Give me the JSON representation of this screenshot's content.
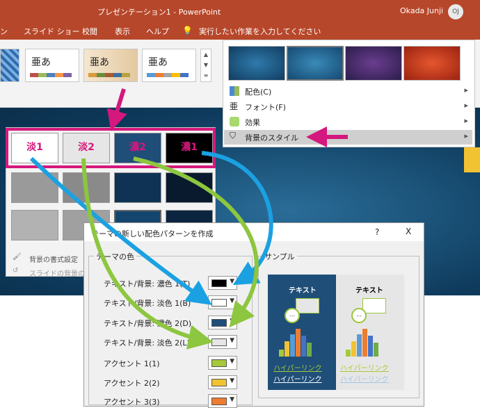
{
  "window": {
    "title": "プレゼンテーション1 - PowerPoint",
    "user": "Okada Junji",
    "user_initials": "OJ"
  },
  "menu": {
    "items": [
      "ン",
      "スライド ショー",
      "校閲",
      "表示",
      "ヘルプ"
    ],
    "tell_me": "実行したい作業を入力してください"
  },
  "themes": [
    {
      "label": "亜あ"
    },
    {
      "label": "亜あ"
    },
    {
      "label": "亜あ"
    }
  ],
  "variant_menu": {
    "items": [
      {
        "label": "配色(C)",
        "icon": "color-scheme-icon"
      },
      {
        "label": "フォント(F)",
        "icon": "font-icon"
      },
      {
        "label": "効果",
        "icon": "effects-icon"
      },
      {
        "label": "背景のスタイル",
        "icon": "background-style-icon"
      }
    ]
  },
  "bg_styles": {
    "highlight_labels": [
      "淡1",
      "淡2",
      "濃2",
      "濃1"
    ],
    "format_background": "背景の書式設定",
    "reset_background": "スライドの背景のリ"
  },
  "dialog": {
    "title": "テーマの新しい配色パターンを作成",
    "help": "?",
    "close": "X",
    "group_theme_colors": "テーマの色",
    "group_sample": "サンプル",
    "rows": [
      {
        "label": "テキスト/背景: 濃色 1(T)",
        "color": "#000000"
      },
      {
        "label": "テキスト/背景: 淡色 1(B)",
        "color": "#ffffff"
      },
      {
        "label": "テキスト/背景: 濃色 2(D)",
        "color": "#1f4e79"
      },
      {
        "label": "テキスト/背景: 淡色 2(L)",
        "color": "#e7e6e6"
      },
      {
        "label": "アクセント 1(1)",
        "color": "#a5c93a"
      },
      {
        "label": "アクセント 2(2)",
        "color": "#f1c232"
      },
      {
        "label": "アクセント 3(3)",
        "color": "#ed7d31"
      }
    ],
    "sample": {
      "text": "テキスト",
      "hyperlink": "ハイパーリンク",
      "hyperlink_visited": "ハイパーリンク",
      "dots": "…"
    }
  },
  "colors": {
    "accent": "#d5187d",
    "arrow_blue": "#1ba1e2",
    "arrow_green": "#8dc63f",
    "ppt": "#b7472a"
  }
}
